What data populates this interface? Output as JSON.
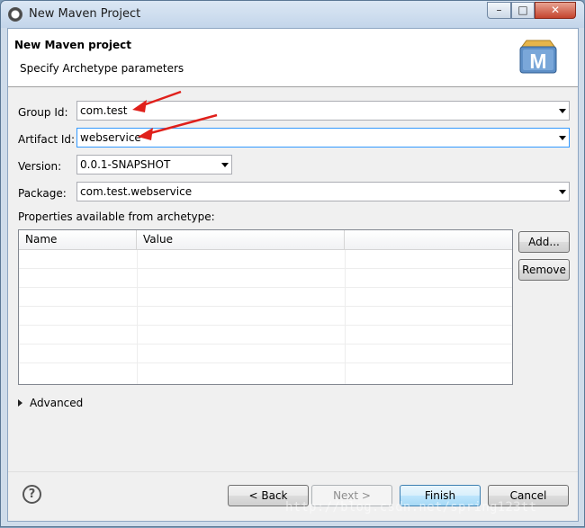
{
  "window": {
    "title": "New Maven Project",
    "controls": {
      "minimize": "–",
      "maximize": "□",
      "close": "✕"
    }
  },
  "banner": {
    "title": "New Maven project",
    "subtitle": "Specify Archetype parameters",
    "logo_letter": "M"
  },
  "form": {
    "group_id": {
      "label": "Group Id:",
      "value": "com.test"
    },
    "artifact_id": {
      "label": "Artifact Id:",
      "value": "webservice"
    },
    "version": {
      "label": "Version:",
      "value": "0.0.1-SNAPSHOT"
    },
    "package": {
      "label": "Package:",
      "value": "com.test.webservice"
    }
  },
  "properties": {
    "label": "Properties available from archetype:",
    "columns": [
      "Name",
      "Value"
    ],
    "rows": [],
    "add_label": "Add...",
    "remove_label": "Remove"
  },
  "advanced": {
    "label": "Advanced"
  },
  "buttons": {
    "help": "?",
    "back": "< Back",
    "next": "Next >",
    "finish": "Finish",
    "cancel": "Cancel"
  },
  "watermark": "http://blog.csdn.net/spring123tt",
  "colors": {
    "annotation_arrow": "#e0201b",
    "focus_border": "#3399ff"
  }
}
